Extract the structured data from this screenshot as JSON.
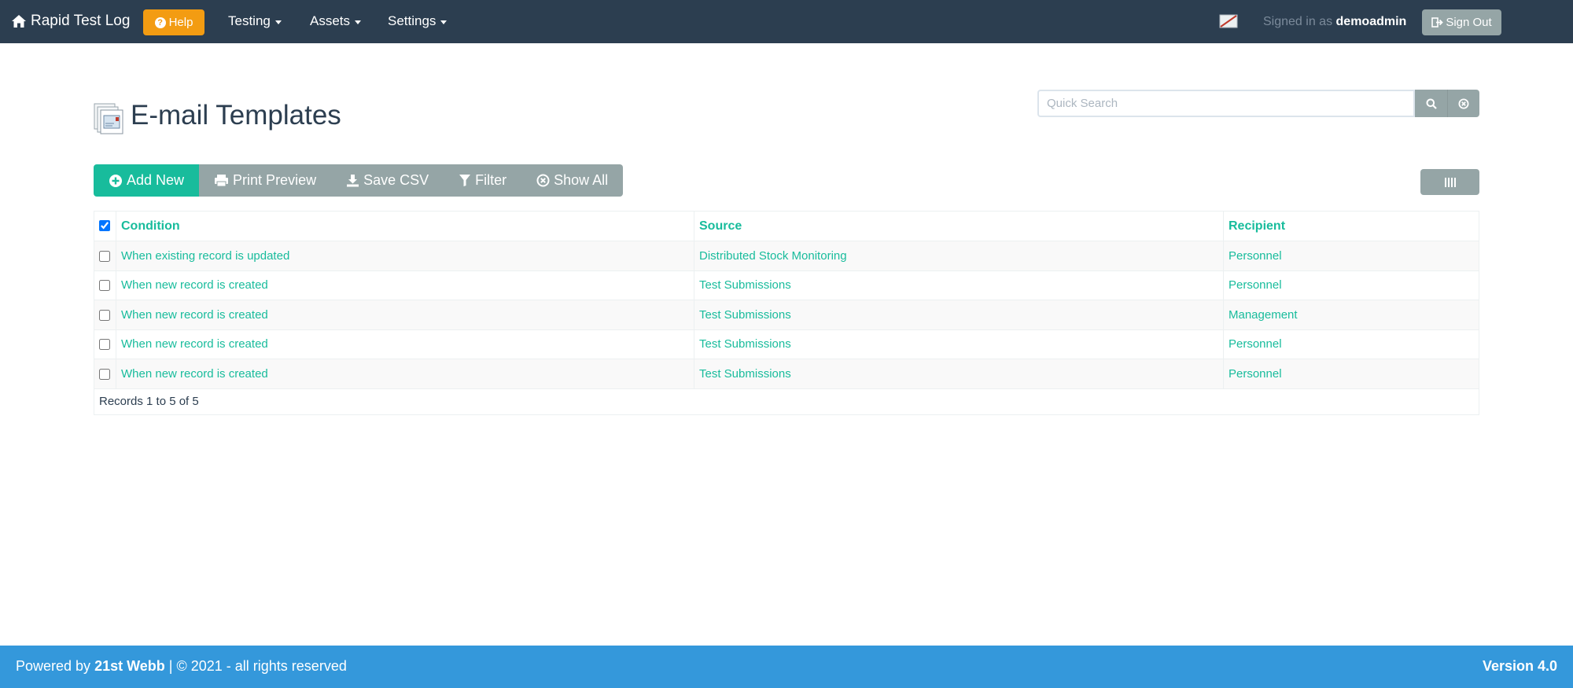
{
  "navbar": {
    "brand": "Rapid Test Log",
    "help_label": "Help",
    "menus": [
      "Testing",
      "Assets",
      "Settings"
    ],
    "signed_in_prefix": "Signed in as",
    "username": "demoadmin",
    "signout_label": "Sign Out"
  },
  "page": {
    "title": "E-mail Templates"
  },
  "search": {
    "placeholder": "Quick Search",
    "value": ""
  },
  "toolbar": {
    "add_new": "Add New",
    "print_preview": "Print Preview",
    "save_csv": "Save CSV",
    "filter": "Filter",
    "show_all": "Show All"
  },
  "table": {
    "columns": [
      "Condition",
      "Source",
      "Recipient"
    ],
    "select_all_checked": true,
    "rows": [
      {
        "condition": "When existing record is updated",
        "source": "Distributed Stock Monitoring",
        "recipient": "Personnel"
      },
      {
        "condition": "When new record is created",
        "source": "Test Submissions",
        "recipient": "Personnel"
      },
      {
        "condition": "When new record is created",
        "source": "Test Submissions",
        "recipient": "Management"
      },
      {
        "condition": "When new record is created",
        "source": "Test Submissions",
        "recipient": "Personnel"
      },
      {
        "condition": "When new record is created",
        "source": "Test Submissions",
        "recipient": "Personnel"
      }
    ],
    "footer": "Records 1 to 5 of 5"
  },
  "footer": {
    "powered_prefix": "Powered by",
    "company": "21st Webb",
    "rights": "| © 2021 - all rights reserved",
    "version": "Version 4.0"
  },
  "colors": {
    "navbar": "#2c3e50",
    "accent": "#18bc9c",
    "help": "#f39c12",
    "secondary": "#95a5a6",
    "footer": "#3498db"
  }
}
